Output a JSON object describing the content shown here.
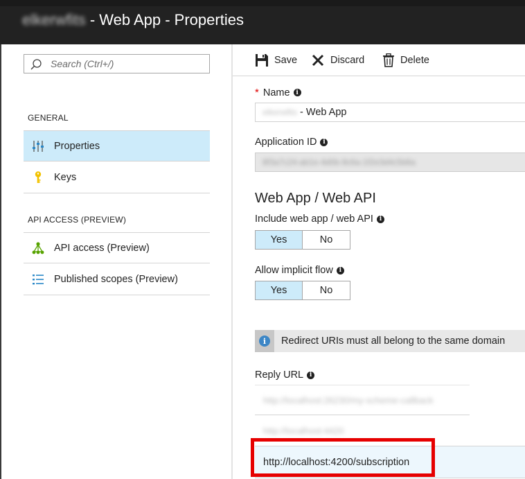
{
  "title": {
    "app_name": "elkerwfits",
    "suffix": "- Web App - Properties"
  },
  "search": {
    "placeholder": "Search (Ctrl+/)"
  },
  "nav": {
    "general_label": "GENERAL",
    "properties_label": "Properties",
    "keys_label": "Keys",
    "api_access_section_label": "API ACCESS (PREVIEW)",
    "api_access_label": "API access (Preview)",
    "published_scopes_label": "Published scopes (Preview)"
  },
  "toolbar": {
    "save_label": "Save",
    "discard_label": "Discard",
    "delete_label": "Delete"
  },
  "form": {
    "name_required": "*",
    "name_label": "Name",
    "name_value_prefix": "elkerwfits",
    "name_value_suffix": " - Web App",
    "app_id_label": "Application ID",
    "app_id_value": "8f3a7c24-ab1e-4d0b-9c6a-1f2e3d4c5b6a",
    "section_title": "Web App / Web API",
    "include_label": "Include web app / web API",
    "include_yes": "Yes",
    "include_no": "No",
    "implicit_label": "Allow implicit flow",
    "implicit_yes": "Yes",
    "implicit_no": "No",
    "notice_text": "Redirect URIs must all belong to the same domain",
    "reply_url_label": "Reply URL",
    "reply_urls": [
      "http://localhost:26230/my-scheme-callback",
      "http://localhost:4420",
      "http://localhost:4200/subscription"
    ]
  },
  "colors": {
    "selected_bg": "#cdebfa",
    "highlight_box": "#e60000",
    "required": "#e00000",
    "info_blue": "#3c86c6"
  }
}
